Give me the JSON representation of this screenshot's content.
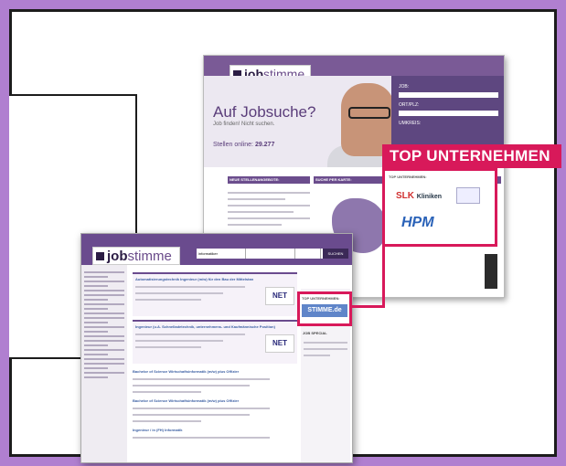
{
  "back_site": {
    "logo": {
      "brand_bold": "job",
      "brand_light": "stimme"
    },
    "hero": {
      "title": "Auf Jobsuche?",
      "subtitle": "Job finden! Nicht suchen.",
      "count_label": "Stellen online:",
      "count_value": "29.277"
    },
    "search_panel": {
      "job_label": "JOB:",
      "region_label": "ORT/PLZ:",
      "radius_label": "UMKREIS:"
    },
    "columns": {
      "neue_stellen": "NEUE STELLENANGEBOTE:",
      "suche_karte": "SUCHE PER KARTE:",
      "top_unternehmen": "TOP UNTERNEHMEN:"
    }
  },
  "front_site": {
    "logo": {
      "brand_bold": "job",
      "brand_light": "stimme"
    },
    "search": {
      "job_value": "informatiker",
      "button": "SUCHEN"
    },
    "results": [
      {
        "title": "Automatisierungstechnik Ingenieur (m/w) für den Bau der Mittelstan",
        "logo": "NET"
      },
      {
        "title": "Ingenieur (u.A. Schnelladetechnik, unternehmens- und Kaufmännische Position)",
        "logo": "NET"
      },
      {
        "title": "Bachelor of Science Wirtschaftsinformatik (m/w) plus Offizier"
      },
      {
        "title": "Bachelor of Science Wirtschaftsinformatik (m/w) plus Offizier"
      },
      {
        "title": "Ingenieur / in (FH) Informatik"
      }
    ],
    "right_column": {
      "top_label": "TOP UNTERNEHMEN:",
      "stimme_logo": "STIMME.de",
      "job_special": "JOB SPECIAL"
    }
  },
  "callout": {
    "label": "TOP UNTERNEHMEN",
    "inner_header": "TOP UNTERNEHMEN:",
    "logo_slk_a": "SLK",
    "logo_slk_b": "Kliniken",
    "logo_hpm": "HPM"
  },
  "colors": {
    "background": "#b07fd0",
    "accent": "#d8195a",
    "brand": "#6a4b8e"
  }
}
